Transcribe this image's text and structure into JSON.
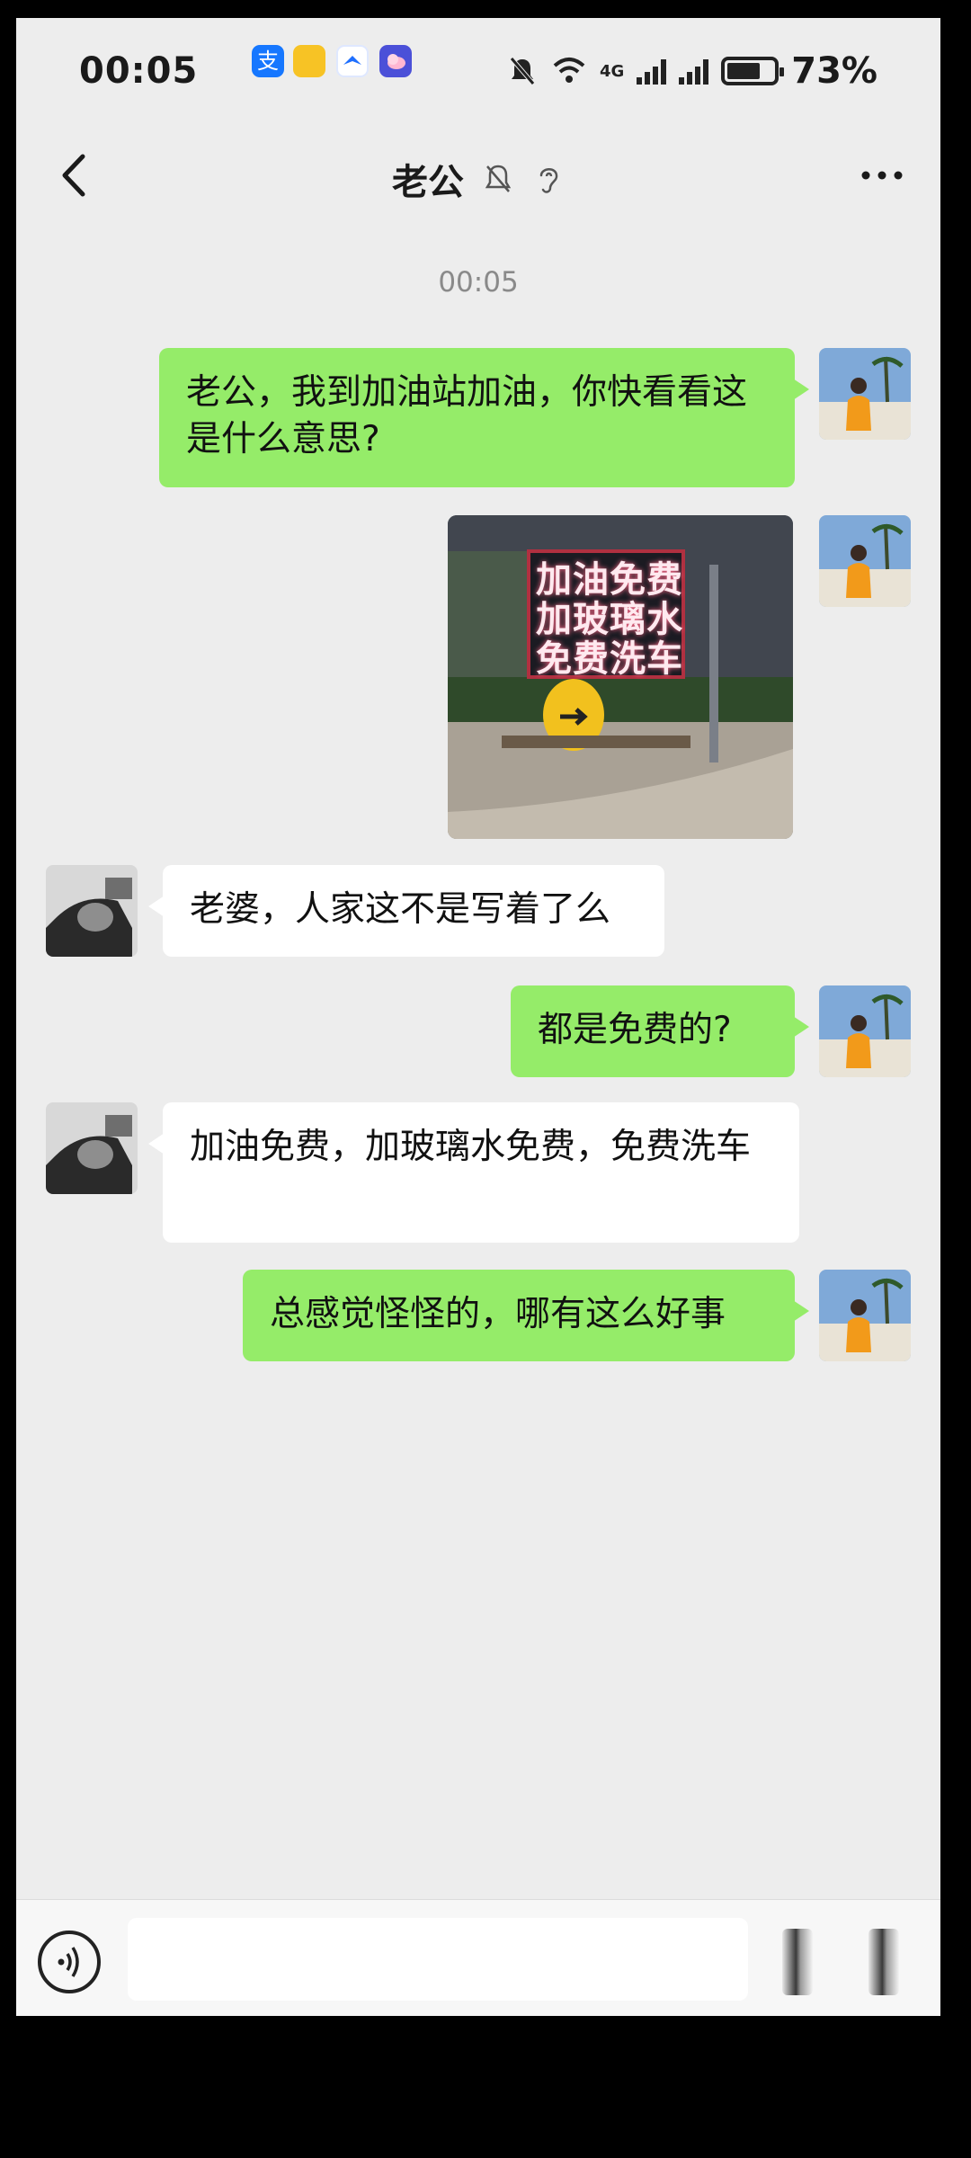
{
  "status_bar": {
    "time": "00:05",
    "network": "4G",
    "battery_level": 0.72,
    "battery_text": "73%"
  },
  "header": {
    "title": "老公",
    "icons": [
      "mute-bell-icon",
      "ear-icon"
    ]
  },
  "chat": {
    "timestamp": "00:05",
    "messages": [
      {
        "sender": "me",
        "type": "text",
        "text": "老公，我到加油站加油，你快看看这是什么意思?"
      },
      {
        "sender": "me",
        "type": "image",
        "sign_lines": [
          "加油免费",
          "加玻璃水",
          "免费洗车"
        ]
      },
      {
        "sender": "other",
        "type": "text",
        "text": "老婆，人家这不是写着了么"
      },
      {
        "sender": "me",
        "type": "text",
        "text": "都是免费的?"
      },
      {
        "sender": "other",
        "type": "text",
        "text": "加油免费，加玻璃水免费，免费洗车"
      },
      {
        "sender": "me",
        "type": "text",
        "text": "总感觉怪怪的，哪有这么好事"
      }
    ]
  },
  "input_bar": {
    "value": "",
    "placeholder": ""
  },
  "colors": {
    "my_bubble": "#95ec69",
    "other_bubble": "#ffffff",
    "background": "#ededed"
  }
}
